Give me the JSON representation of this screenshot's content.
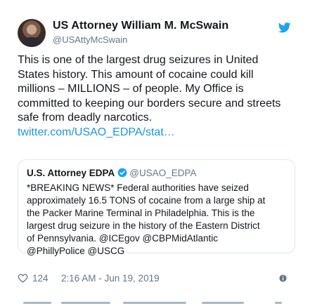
{
  "author": {
    "display_name": "US Attorney William M. McSwain",
    "handle": "@USAttyMcSwain",
    "avatar_icon": "profile-photo",
    "platform_icon": "twitter-bird-icon"
  },
  "tweet": {
    "lines": [
      "This is one of the largest drug seizures in United",
      "States history. This amount of cocaine could kill",
      "millions – MILLIONS – of people. My Office is",
      "committed to keeping our borders secure and streets",
      "safe from deadly narcotics."
    ],
    "link": "twitter.com/USAO_EDPA/stat…"
  },
  "quoted": {
    "display_name": "U.S. Attorney EDPA",
    "verified_icon": "verified-badge-icon",
    "handle": "@USAO_EDPA",
    "lines": [
      "*BREAKING NEWS* Federal authorities have seized",
      "approximately 16.5 TONS of cocaine from a large ship at",
      "the Packer Marine Terminal in Philadelphia. This is the",
      "largest drug seizure in the history of the Eastern District",
      "of Pennsylvania. @ICEgov @CBPMidAtlantic",
      "@PhillyPolice @USCG"
    ]
  },
  "footer": {
    "like_count": "124",
    "timestamp": "2:16 AM - Jun 19, 2019",
    "like_icon": "heart-icon",
    "info_icon": "info-icon"
  },
  "colors": {
    "text": "#14171a",
    "secondary": "#657786",
    "link": "#1b95e0",
    "border": "#e1e8ed",
    "brand": "#1da1f2"
  }
}
